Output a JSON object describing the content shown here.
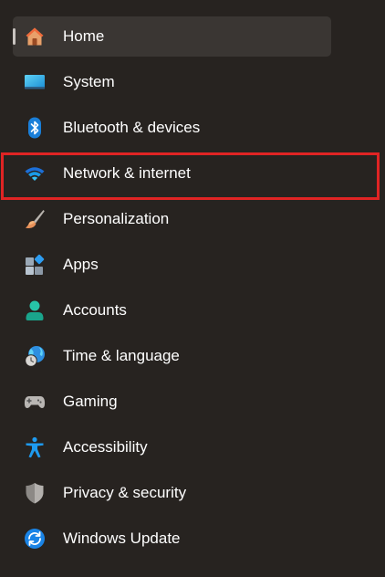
{
  "nav": {
    "items": [
      {
        "label": "Home",
        "icon": "home-icon",
        "selected": true
      },
      {
        "label": "System",
        "icon": "monitor-icon"
      },
      {
        "label": "Bluetooth & devices",
        "icon": "bluetooth-icon"
      },
      {
        "label": "Network & internet",
        "icon": "wifi-icon"
      },
      {
        "label": "Personalization",
        "icon": "paintbrush-icon"
      },
      {
        "label": "Apps",
        "icon": "apps-icon"
      },
      {
        "label": "Accounts",
        "icon": "account-icon"
      },
      {
        "label": "Time & language",
        "icon": "globe-clock-icon"
      },
      {
        "label": "Gaming",
        "icon": "gamepad-icon"
      },
      {
        "label": "Accessibility",
        "icon": "accessibility-icon"
      },
      {
        "label": "Privacy & security",
        "icon": "shield-icon"
      },
      {
        "label": "Windows Update",
        "icon": "update-icon"
      }
    ]
  },
  "colors": {
    "background": "#272320",
    "selected_background": "#3a3633",
    "highlight_border": "#e02424",
    "text": "#ffffff",
    "accent": "#0f8de0"
  }
}
